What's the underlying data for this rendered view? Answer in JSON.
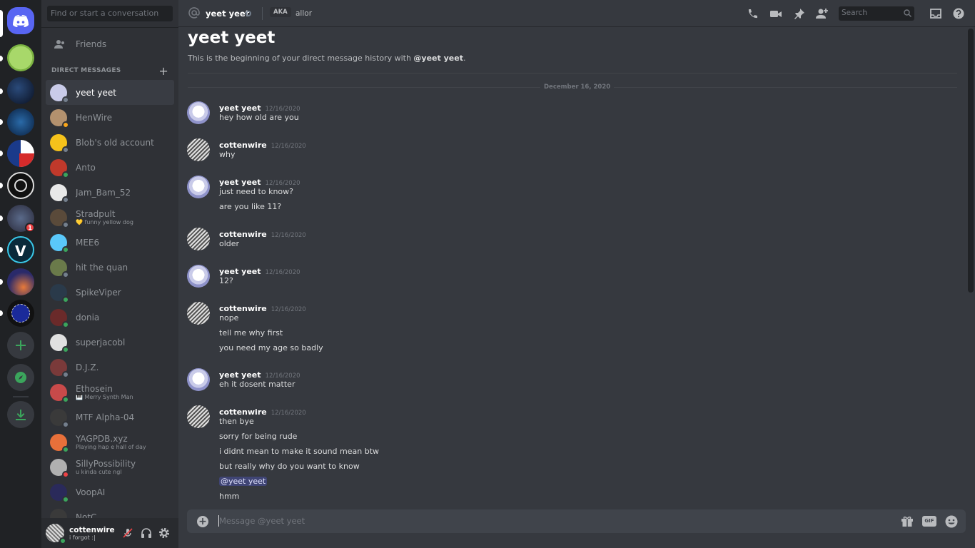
{
  "sidebar": {
    "search_placeholder": "Find or start a conversation",
    "friends_label": "Friends",
    "dm_header": "DIRECT MESSAGES",
    "add_dm": "+",
    "dms": [
      {
        "name": "yeet yeet",
        "sub": "",
        "status": "off",
        "color": "#c9cbe9",
        "selected": true
      },
      {
        "name": "HenWire",
        "sub": "",
        "status": "idle",
        "color": "#b3916e"
      },
      {
        "name": "Blob's old account",
        "sub": "",
        "status": "off",
        "color": "#f5c21b"
      },
      {
        "name": "Anto",
        "sub": "",
        "status": "on",
        "color": "#c0392b"
      },
      {
        "name": "Jam_Bam_52",
        "sub": "",
        "status": "off",
        "color": "#e8e8e8"
      },
      {
        "name": "Stradpult",
        "sub": "💛 funny yellow dog",
        "status": "off",
        "color": "#5a4a3a"
      },
      {
        "name": "MEE6",
        "sub": "",
        "status": "on",
        "color": "#5ac8fa"
      },
      {
        "name": "hit the quan",
        "sub": "",
        "status": "off",
        "color": "#6a7a4a"
      },
      {
        "name": "SpikeViper",
        "sub": "",
        "status": "on",
        "color": "#2a3a4a"
      },
      {
        "name": "donia",
        "sub": "",
        "status": "on",
        "color": "#6a2a2a"
      },
      {
        "name": "superjacobl",
        "sub": "",
        "status": "on",
        "color": "#e0e0e0"
      },
      {
        "name": "D.J.Z.",
        "sub": "",
        "status": "off",
        "color": "#7a3a3a"
      },
      {
        "name": "Ethosein",
        "sub": "🎹 Merry Synth Man",
        "status": "on",
        "color": "#c84a4a"
      },
      {
        "name": "MTF Alpha-04",
        "sub": "",
        "status": "off",
        "color": "#3a3a3a"
      },
      {
        "name": "YAGPDB.xyz",
        "sub": "Playing hap e hall of day",
        "status": "on",
        "color": "#e8703a"
      },
      {
        "name": "SillyPossibility",
        "sub": "u kinda cute ngl",
        "status": "dnd",
        "color": "#b0b0b0"
      },
      {
        "name": "VoopAI",
        "sub": "",
        "status": "on",
        "color": "#2a2a5a"
      },
      {
        "name": "NotC...",
        "sub": "",
        "status": "on",
        "color": "#3a3a3a"
      }
    ]
  },
  "user_panel": {
    "name": "cottenwire",
    "status": "i forgot :|"
  },
  "topbar": {
    "at_icon": "at-icon",
    "name": "yeet yeet",
    "aka_label": "AKA",
    "aka_name": "allor",
    "search_placeholder": "Search"
  },
  "chat": {
    "title": "yeet yeet",
    "intro_prefix": "This is the beginning of your direct message history with ",
    "intro_mention": "@yeet yeet",
    "intro_suffix": ".",
    "date_divider": "December 16, 2020",
    "groups": [
      {
        "author": "yeet yeet",
        "time": "12/16/2020",
        "av": "yeet",
        "lines": [
          "hey how old are you"
        ]
      },
      {
        "author": "cottenwire",
        "time": "12/16/2020",
        "av": "cotton",
        "lines": [
          "why"
        ]
      },
      {
        "author": "yeet yeet",
        "time": "12/16/2020",
        "av": "yeet",
        "lines": [
          "just need to know?",
          "are you like 11?"
        ]
      },
      {
        "author": "cottenwire",
        "time": "12/16/2020",
        "av": "cotton",
        "lines": [
          "older"
        ]
      },
      {
        "author": "yeet yeet",
        "time": "12/16/2020",
        "av": "yeet",
        "lines": [
          "12?"
        ]
      },
      {
        "author": "cottenwire",
        "time": "12/16/2020",
        "av": "cotton",
        "lines": [
          "nope",
          "tell me why first",
          "you need my age so badly"
        ]
      },
      {
        "author": "yeet yeet",
        "time": "12/16/2020",
        "av": "yeet",
        "lines": [
          "eh it dosent matter"
        ]
      },
      {
        "author": "cottenwire",
        "time": "12/16/2020",
        "av": "cotton",
        "lines": [
          "then bye",
          "sorry for being rude",
          "i didnt mean to make it sound mean btw",
          "but really why do you want to know",
          "@yeet yeet",
          "hmm"
        ]
      }
    ]
  },
  "composer": {
    "placeholder": "Message @yeet yeet",
    "gif_label": "GIF"
  },
  "servers": {
    "badge_count": "1"
  }
}
